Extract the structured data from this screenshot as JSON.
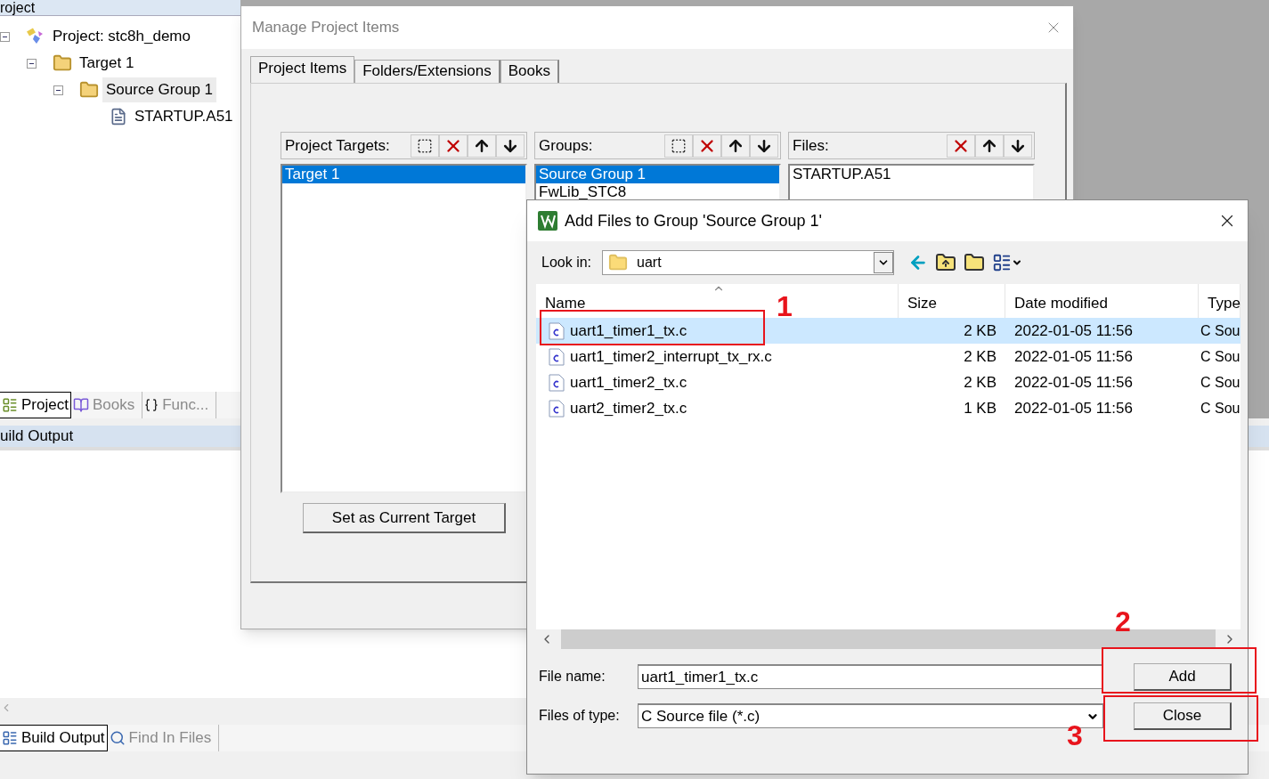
{
  "ide": {
    "panel_title": "roject",
    "tree": [
      {
        "label": "Project: stc8h_demo",
        "kind": "project",
        "expanded": true,
        "selected": false,
        "children": [
          {
            "label": "Target 1",
            "kind": "target",
            "expanded": true,
            "selected": false,
            "children": [
              {
                "label": "Source Group 1",
                "kind": "group",
                "expanded": true,
                "selected": true,
                "children": [
                  {
                    "label": "STARTUP.A51",
                    "kind": "file",
                    "selected": false
                  }
                ]
              }
            ]
          }
        ]
      }
    ],
    "panel_tabs": [
      {
        "label": "Project",
        "kind": "project",
        "selected": true
      },
      {
        "label": "Books",
        "kind": "books",
        "selected": false
      },
      {
        "label": "Func...",
        "kind": "functions",
        "selected": false
      }
    ],
    "output_title": "uild Output",
    "bottom_tabs": [
      {
        "label": "Build Output",
        "kind": "output",
        "selected": true
      },
      {
        "label": "Find In Files",
        "kind": "find",
        "selected": false
      }
    ]
  },
  "manage_dialog": {
    "title": "Manage Project Items",
    "tabs": [
      {
        "label": "Project Items",
        "selected": true
      },
      {
        "label": "Folders/Extensions",
        "selected": false
      },
      {
        "label": "Books",
        "selected": false
      }
    ],
    "lists": [
      {
        "label": "Project Targets:",
        "tools": [
          {
            "kind": "new"
          },
          {
            "kind": "delete"
          },
          {
            "kind": "up"
          },
          {
            "kind": "down"
          }
        ],
        "items": [
          {
            "text": "Target 1",
            "selected": true
          }
        ]
      },
      {
        "label": "Groups:",
        "tools": [
          {
            "kind": "new"
          },
          {
            "kind": "delete"
          },
          {
            "kind": "up"
          },
          {
            "kind": "down"
          }
        ],
        "items": [
          {
            "text": "Source Group 1",
            "selected": true
          },
          {
            "text": "FwLib_STC8",
            "selected": false
          }
        ]
      },
      {
        "label": "Files:",
        "tools": [
          {
            "kind": "delete"
          },
          {
            "kind": "up"
          },
          {
            "kind": "down"
          }
        ],
        "items": [
          {
            "text": "STARTUP.A51",
            "selected": false
          }
        ]
      }
    ],
    "button": "Set as Current Target"
  },
  "add_dialog": {
    "title": "Add Files to Group 'Source Group 1'",
    "look_in_label": "Look in:",
    "look_in": "uart",
    "columns": [
      "Name",
      "Size",
      "Date modified",
      "Type"
    ],
    "rows": [
      {
        "name": "uart1_timer1_tx.c",
        "size": "2 KB",
        "date": "2022-01-05 11:56",
        "type": "C Sou",
        "selected": true
      },
      {
        "name": "uart1_timer2_interrupt_tx_rx.c",
        "size": "2 KB",
        "date": "2022-01-05 11:56",
        "type": "C Sou",
        "selected": false
      },
      {
        "name": "uart1_timer2_tx.c",
        "size": "2 KB",
        "date": "2022-01-05 11:56",
        "type": "C Sou",
        "selected": false
      },
      {
        "name": "uart2_timer2_tx.c",
        "size": "1 KB",
        "date": "2022-01-05 11:56",
        "type": "C Sou",
        "selected": false
      }
    ],
    "file_name_label": "File name:",
    "file_name": "uart1_timer1_tx.c",
    "file_type_label": "Files of type:",
    "file_type": "C Source file (*.c)",
    "buttons": [
      "Add",
      "Close"
    ]
  },
  "annotations": [
    {
      "label": "1"
    },
    {
      "label": "2"
    },
    {
      "label": "3"
    }
  ]
}
